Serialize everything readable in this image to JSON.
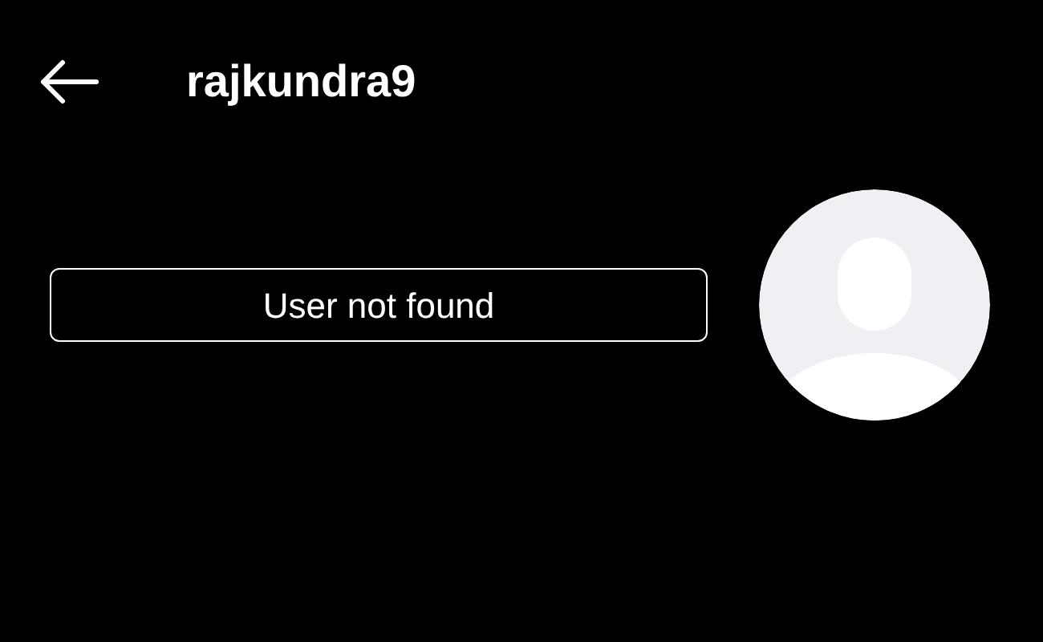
{
  "header": {
    "username": "rajkundra9"
  },
  "profile": {
    "status_button": "User not found"
  }
}
